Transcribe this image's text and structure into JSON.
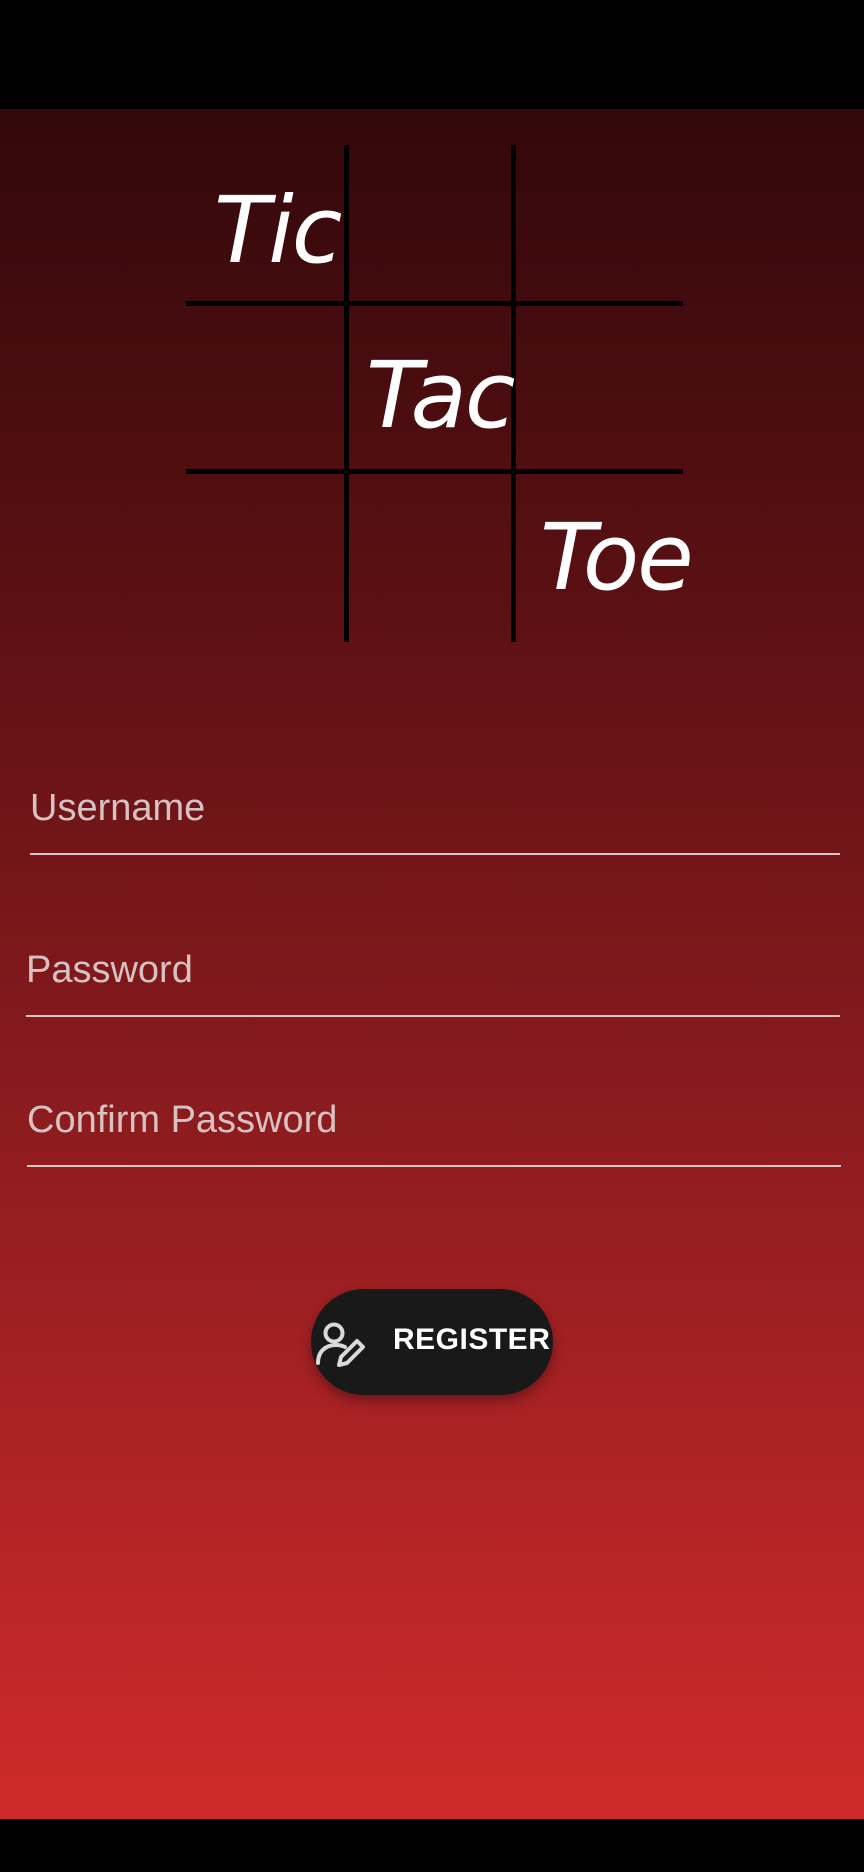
{
  "logo": {
    "words": [
      "Tic",
      "Tac",
      "Toe"
    ]
  },
  "form": {
    "username_placeholder": "Username",
    "password_placeholder": "Password",
    "confirm_placeholder": "Confirm Password"
  },
  "register": {
    "label": "REGISTER",
    "icon": "user-edit-icon"
  },
  "colors": {
    "gradient_top": "#32080a",
    "gradient_bottom": "#cf2a2b",
    "button_bg": "#191919",
    "placeholder_text": "#d8c1c2"
  }
}
